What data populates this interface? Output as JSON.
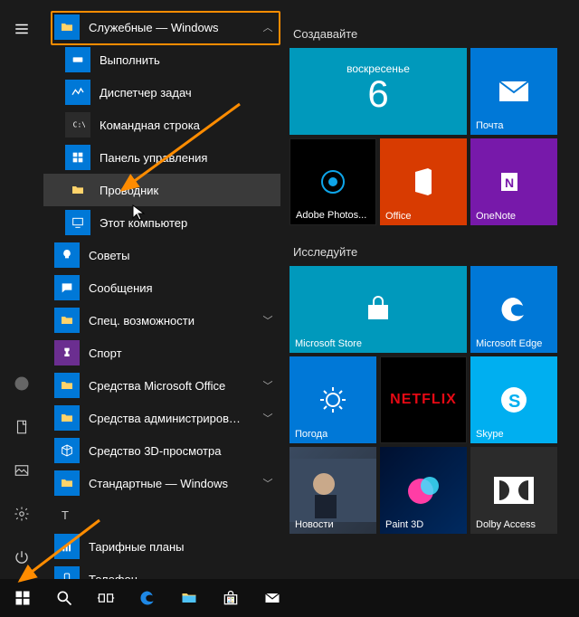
{
  "highlighted_folder": "Служебные — Windows",
  "sub_items": [
    {
      "id": "run",
      "label": "Выполнить"
    },
    {
      "id": "taskmgr",
      "label": "Диспетчер задач"
    },
    {
      "id": "cmd",
      "label": "Командная строка"
    },
    {
      "id": "control",
      "label": "Панель управления"
    },
    {
      "id": "explorer",
      "label": "Проводник"
    },
    {
      "id": "thispc",
      "label": "Этот компьютер"
    }
  ],
  "apps": [
    {
      "id": "tips",
      "label": "Советы",
      "expandable": false
    },
    {
      "id": "messages",
      "label": "Сообщения",
      "expandable": false
    },
    {
      "id": "accessibility",
      "label": "Спец. возможности",
      "expandable": true
    },
    {
      "id": "sport",
      "label": "Спорт",
      "expandable": false
    },
    {
      "id": "office-tools",
      "label": "Средства Microsoft Office",
      "expandable": true
    },
    {
      "id": "admin-tools",
      "label": "Средства администрирования...",
      "expandable": true
    },
    {
      "id": "3dviewer",
      "label": "Средство 3D-просмотра",
      "expandable": false
    },
    {
      "id": "accessories",
      "label": "Стандартные — Windows",
      "expandable": true
    }
  ],
  "section_letter": "Т",
  "apps_t": [
    {
      "id": "tariff",
      "label": "Тарифные планы"
    },
    {
      "id": "phone",
      "label": "Телефон"
    }
  ],
  "tiles": {
    "group1_title": "Создавайте",
    "group2_title": "Исследуйте",
    "calendar": {
      "day": "воскресенье",
      "num": "6"
    },
    "mail": "Почта",
    "photoshop": "Adobe Photos...",
    "office": "Office",
    "onenote": "OneNote",
    "store": "Microsoft Store",
    "edge": "Microsoft Edge",
    "weather": "Погода",
    "netflix": "NETFLIX",
    "skype": "Skype",
    "news": "Новости",
    "paint3d": "Paint 3D",
    "dolby": "Dolby Access"
  }
}
